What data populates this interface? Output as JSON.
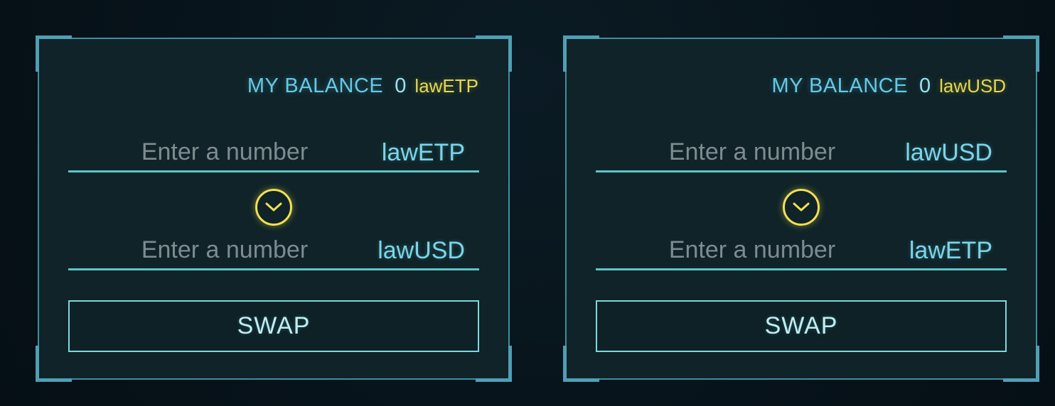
{
  "panels": [
    {
      "balance_label": "MY BALANCE",
      "balance_value": "0",
      "balance_token": "lawETP",
      "from": {
        "placeholder": "Enter a number",
        "token": "lawETP"
      },
      "to": {
        "placeholder": "Enter a number",
        "token": "lawUSD"
      },
      "direction_icon": "chevron-down-circle-icon",
      "swap_label": "SWAP"
    },
    {
      "balance_label": "MY BALANCE",
      "balance_value": "0",
      "balance_token": "lawUSD",
      "from": {
        "placeholder": "Enter a number",
        "token": "lawUSD"
      },
      "to": {
        "placeholder": "Enter a number",
        "token": "lawETP"
      },
      "direction_icon": "chevron-down-circle-icon",
      "swap_label": "SWAP"
    }
  ],
  "colors": {
    "background": "#07131a",
    "panel": "#0f2328",
    "accent_cyan": "#65c9e6",
    "accent_yellow": "#e6d84d"
  }
}
